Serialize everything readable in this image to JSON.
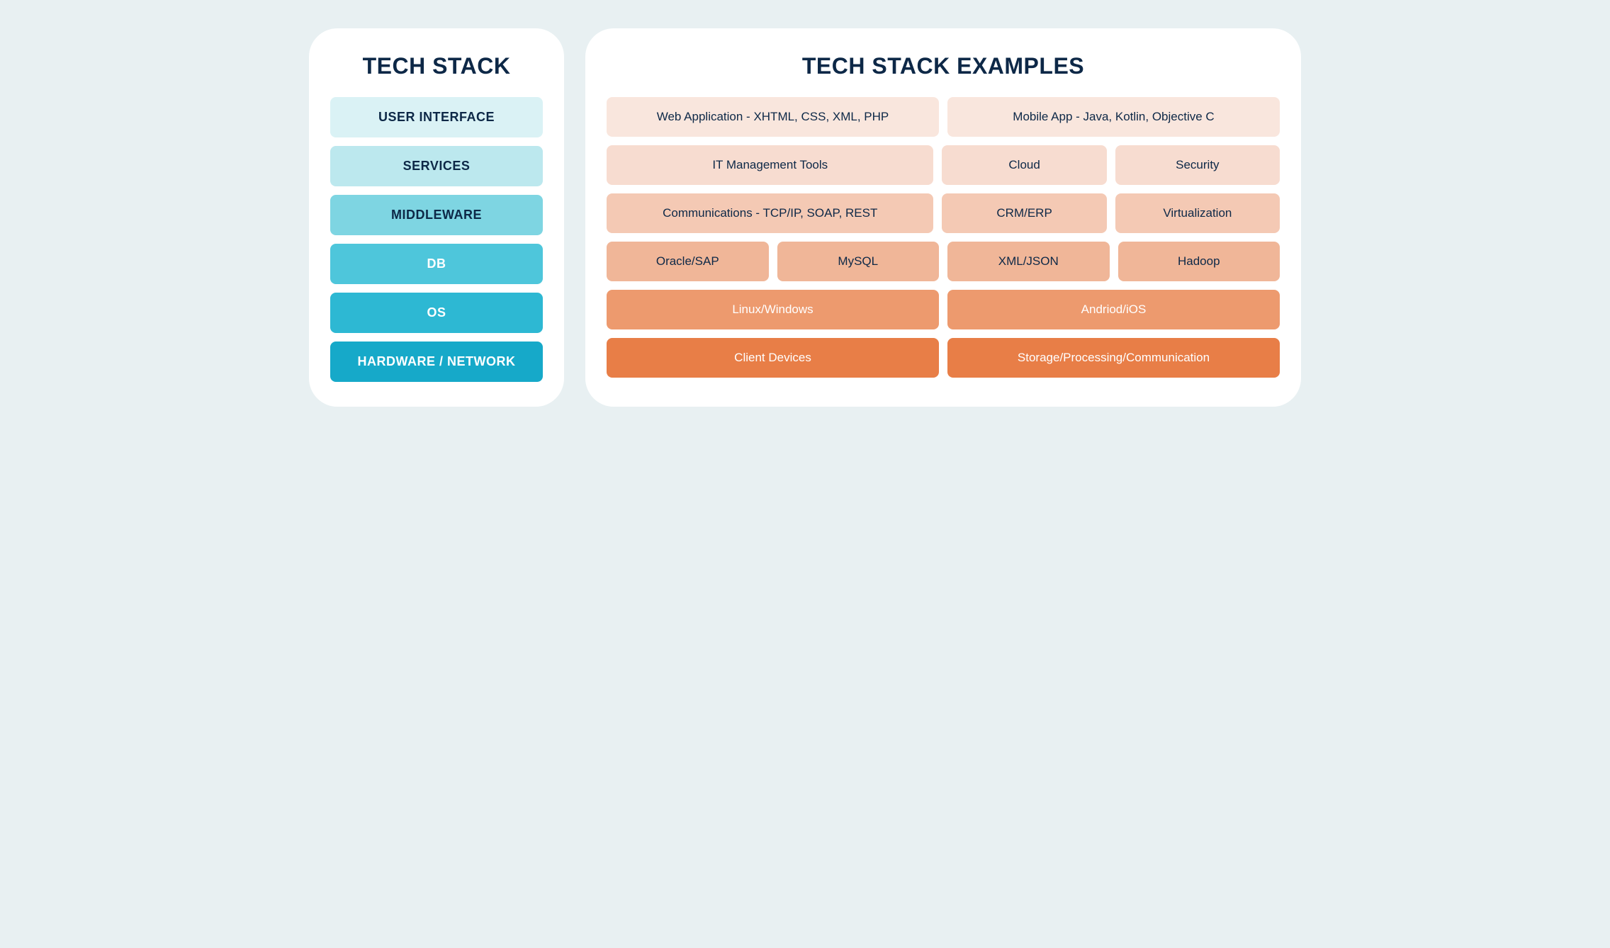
{
  "left": {
    "title": "TECH STACK",
    "layers": [
      "USER INTERFACE",
      "SERVICES",
      "MIDDLEWARE",
      "DB",
      "OS",
      "HARDWARE / NETWORK"
    ]
  },
  "right": {
    "title": "TECH STACK EXAMPLES",
    "rows": [
      [
        "Web Application - XHTML, CSS, XML, PHP",
        "Mobile App - Java, Kotlin, Objective C"
      ],
      [
        "IT Management Tools",
        "Cloud",
        "Security"
      ],
      [
        "Communications - TCP/IP, SOAP, REST",
        "CRM/ERP",
        "Virtualization"
      ],
      [
        "Oracle/SAP",
        "MySQL",
        "XML/JSON",
        "Hadoop"
      ],
      [
        "Linux/Windows",
        "Andriod/iOS"
      ],
      [
        "Client Devices",
        "Storage/Processing/Communication"
      ]
    ]
  }
}
